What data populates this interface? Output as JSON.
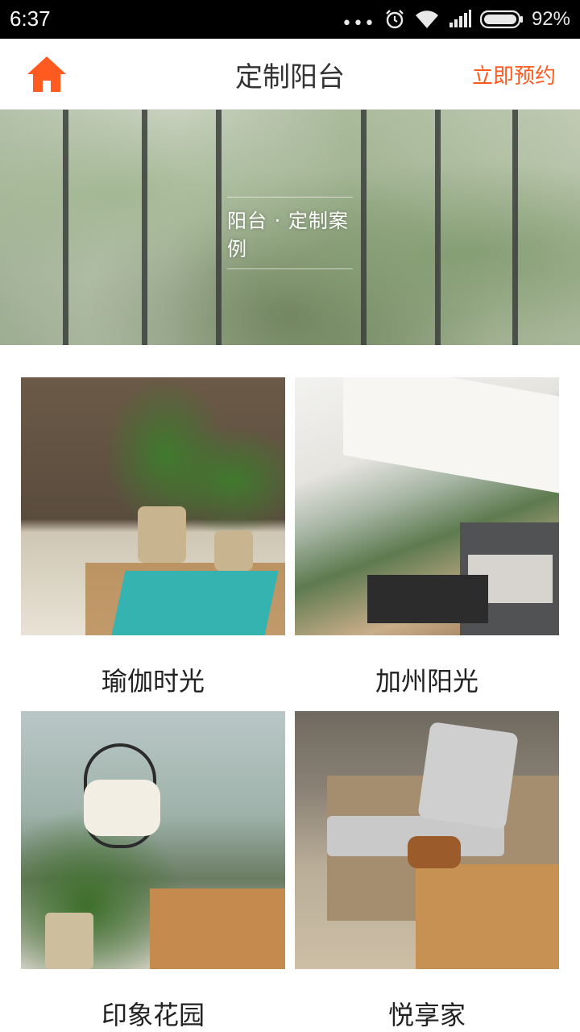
{
  "status_bar": {
    "time": "6:37",
    "dots": "•••",
    "battery_percent": "92%",
    "icons": [
      "alarm-icon",
      "wifi-icon",
      "signal-icon",
      "battery-icon"
    ]
  },
  "navbar": {
    "title": "定制阳台",
    "book_label": "立即预约",
    "home_icon": "home-icon",
    "accent_color": "#ff5a1f"
  },
  "banner": {
    "caption": "阳台 · 定制案例"
  },
  "cases": [
    {
      "label": "瑜伽时光"
    },
    {
      "label": "加州阳光"
    },
    {
      "label": "印象花园"
    },
    {
      "label": "悦享家"
    }
  ]
}
